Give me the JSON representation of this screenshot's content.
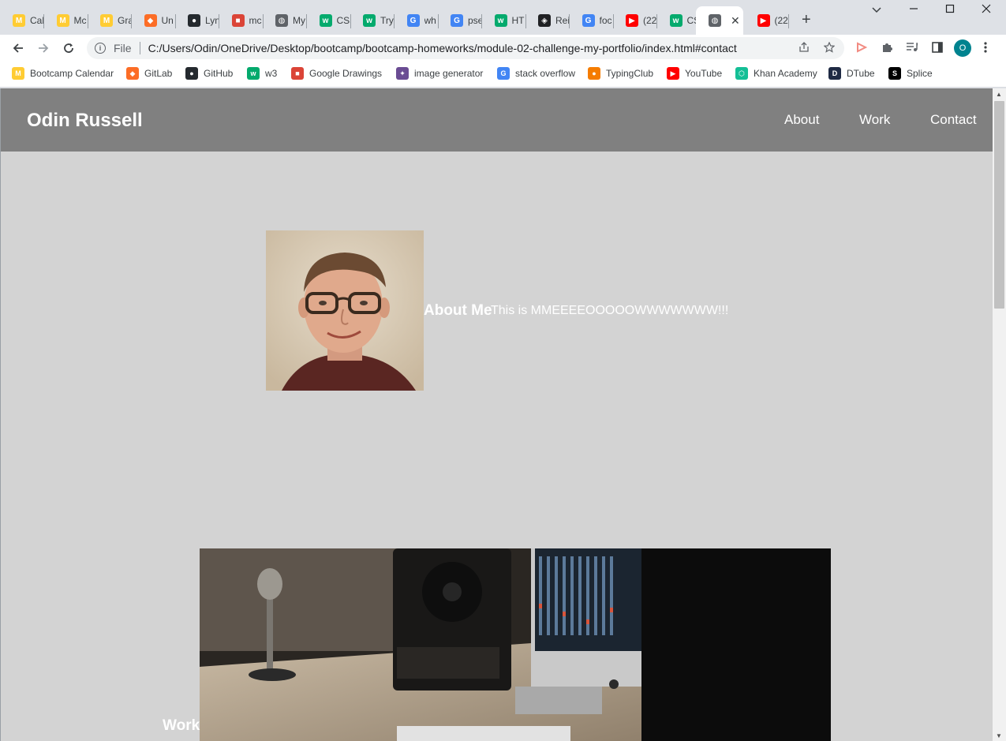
{
  "tabs": [
    {
      "title": "Cal",
      "icon": "umn-icon",
      "color": "#ffcc33"
    },
    {
      "title": "Mc",
      "icon": "umn-icon",
      "color": "#ffcc33"
    },
    {
      "title": "Gra",
      "icon": "umn-icon",
      "color": "#ffcc33"
    },
    {
      "title": "Un",
      "icon": "gitlab-icon",
      "color": "#fc6d26"
    },
    {
      "title": "Lyn",
      "icon": "github-icon",
      "color": "#24292e"
    },
    {
      "title": "mc",
      "icon": "drawings-icon",
      "color": "#db4437"
    },
    {
      "title": "My",
      "icon": "globe-icon",
      "color": "#5f6368"
    },
    {
      "title": "CSS",
      "icon": "w3-icon",
      "color": "#04aa6d"
    },
    {
      "title": "Try",
      "icon": "w3-icon",
      "color": "#04aa6d"
    },
    {
      "title": "wh",
      "icon": "google-icon",
      "color": "#4285f4"
    },
    {
      "title": "pse",
      "icon": "google-icon",
      "color": "#4285f4"
    },
    {
      "title": "HT",
      "icon": "w3-icon",
      "color": "#04aa6d"
    },
    {
      "title": "Rei",
      "icon": "site-icon",
      "color": "#202124"
    },
    {
      "title": "foc",
      "icon": "google-icon",
      "color": "#4285f4"
    },
    {
      "title": "(22",
      "icon": "youtube-icon",
      "color": "#ff0000"
    },
    {
      "title": "CSS",
      "icon": "w3-icon",
      "color": "#04aa6d"
    },
    {
      "title": "",
      "icon": "globe-icon",
      "color": "#5f6368",
      "active": true
    },
    {
      "title": "(22",
      "icon": "youtube-icon",
      "color": "#ff0000"
    }
  ],
  "toolbar": {
    "file_label": "File",
    "url": "C:/Users/Odin/OneDrive/Desktop/bootcamp/bootcamp-homeworks/module-02-challenge-my-portfolio/index.html#contact",
    "profile_initial": "O"
  },
  "bookmarks": [
    {
      "label": "Bootcamp Calendar",
      "icon": "umn-icon",
      "color": "#ffcc33"
    },
    {
      "label": "GitLab",
      "icon": "gitlab-icon",
      "color": "#fc6d26"
    },
    {
      "label": "GitHub",
      "icon": "github-icon",
      "color": "#24292e"
    },
    {
      "label": "w3",
      "icon": "w3-icon",
      "color": "#04aa6d"
    },
    {
      "label": "Google Drawings",
      "icon": "drawings-icon",
      "color": "#db4437"
    },
    {
      "label": "image generator",
      "icon": "generator-icon",
      "color": "#6a4c93"
    },
    {
      "label": "stack overflow",
      "icon": "google-icon",
      "color": "#4285f4"
    },
    {
      "label": "TypingClub",
      "icon": "typingclub-icon",
      "color": "#f57c00"
    },
    {
      "label": "YouTube",
      "icon": "youtube-icon",
      "color": "#ff0000"
    },
    {
      "label": "Khan Academy",
      "icon": "khan-icon",
      "color": "#14bf96"
    },
    {
      "label": "DTube",
      "icon": "dtube-icon",
      "color": "#1f2a44"
    },
    {
      "label": "Splice",
      "icon": "splice-icon",
      "color": "#000000"
    }
  ],
  "site": {
    "title": "Odin Russell",
    "nav": [
      "About",
      "Work",
      "Contact"
    ],
    "about_heading": "About Me",
    "about_text": "This is MMEEEEOOOOOWWWWWWW!!!",
    "work_heading": "Work"
  },
  "colors": {
    "header_bg": "#808080",
    "page_bg": "#d3d3d3"
  }
}
